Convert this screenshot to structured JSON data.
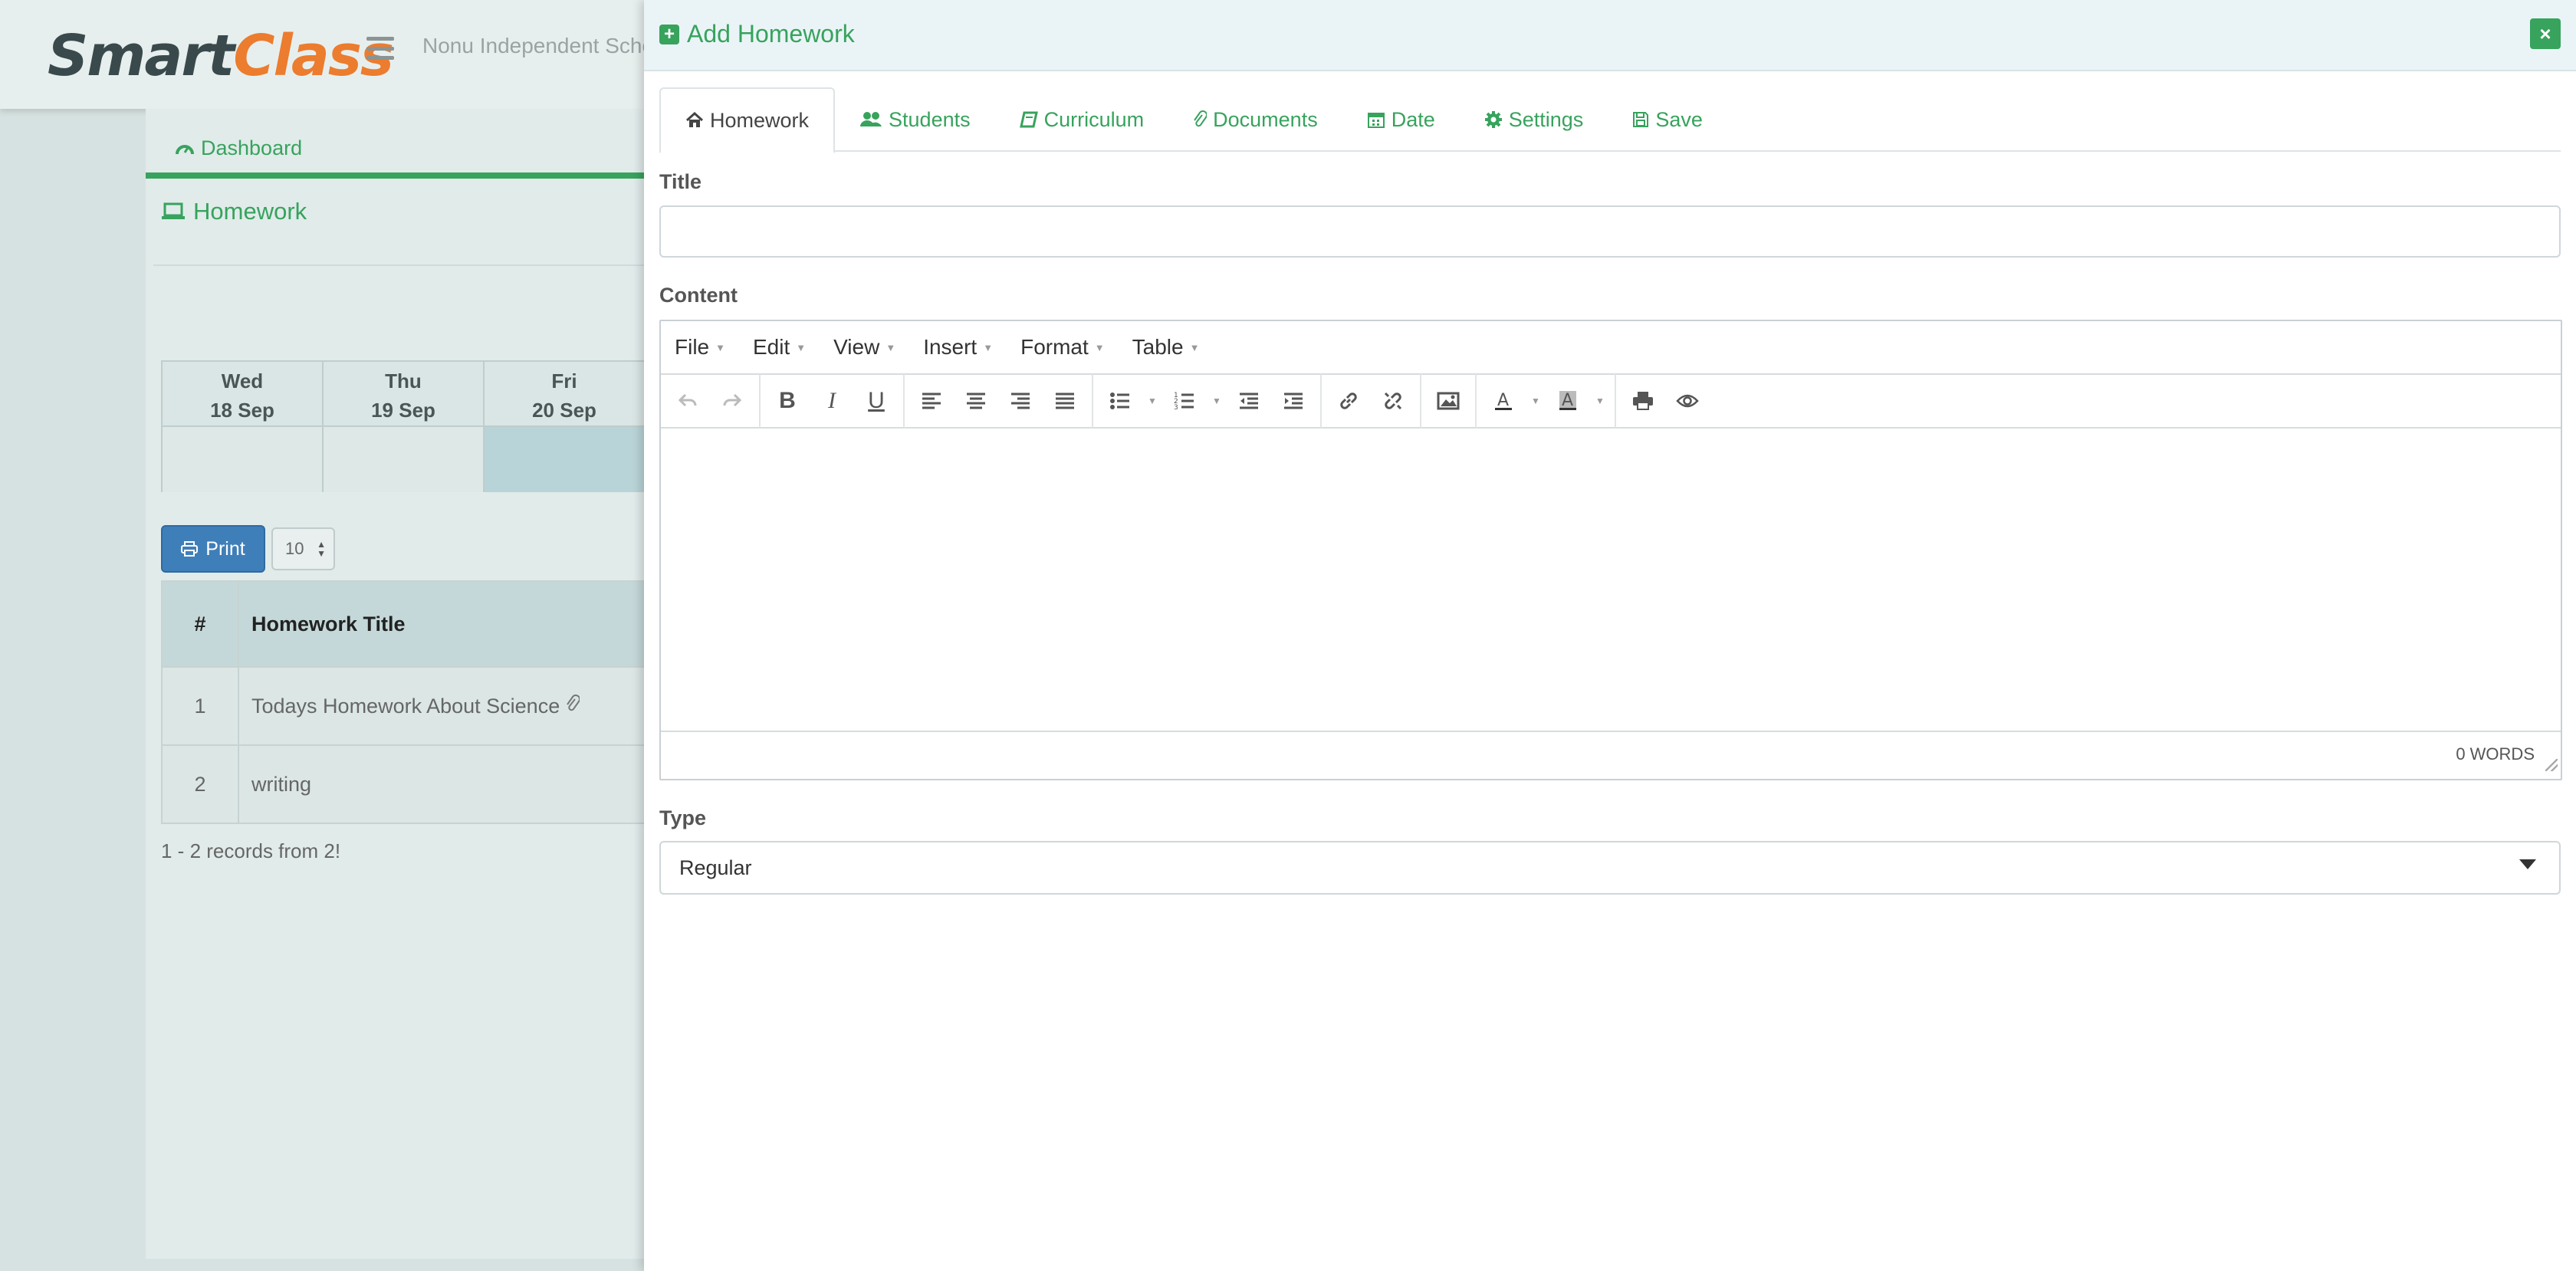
{
  "app": {
    "logo_smart": "Smart",
    "logo_class": "Class",
    "school_name": "Nonu Independent Scho"
  },
  "background": {
    "dashboard_link": "Dashboard",
    "section_title": "Homework",
    "calendar": [
      {
        "day": "Wed",
        "date": "18 Sep"
      },
      {
        "day": "Thu",
        "date": "19 Sep"
      },
      {
        "day": "Fri",
        "date": "20 Sep"
      }
    ],
    "print_label": "Print",
    "page_size": "10",
    "table": {
      "headers": [
        "#",
        "Homework Title"
      ],
      "rows": [
        {
          "num": "1",
          "title": "Todays Homework About Science"
        },
        {
          "num": "2",
          "title": "writing"
        }
      ]
    },
    "records_text": "1 - 2 records from 2!"
  },
  "modal": {
    "title": "Add Homework",
    "close_label": "×",
    "tabs": [
      {
        "label": "Homework",
        "icon": "home-icon"
      },
      {
        "label": "Students",
        "icon": "users-icon"
      },
      {
        "label": "Curriculum",
        "icon": "book-icon"
      },
      {
        "label": "Documents",
        "icon": "paperclip-icon"
      },
      {
        "label": "Date",
        "icon": "calendar-icon"
      },
      {
        "label": "Settings",
        "icon": "gear-icon"
      },
      {
        "label": "Save",
        "icon": "save-icon"
      }
    ],
    "title_label": "Title",
    "title_value": "",
    "content_label": "Content",
    "editor_menus": [
      "File",
      "Edit",
      "View",
      "Insert",
      "Format",
      "Table"
    ],
    "word_count": "0 WORDS",
    "type_label": "Type",
    "type_value": "Regular"
  },
  "colors": {
    "accent_green": "#37a35d",
    "print_blue": "#3f7fb9",
    "logo_orange": "#ec7c2e"
  }
}
